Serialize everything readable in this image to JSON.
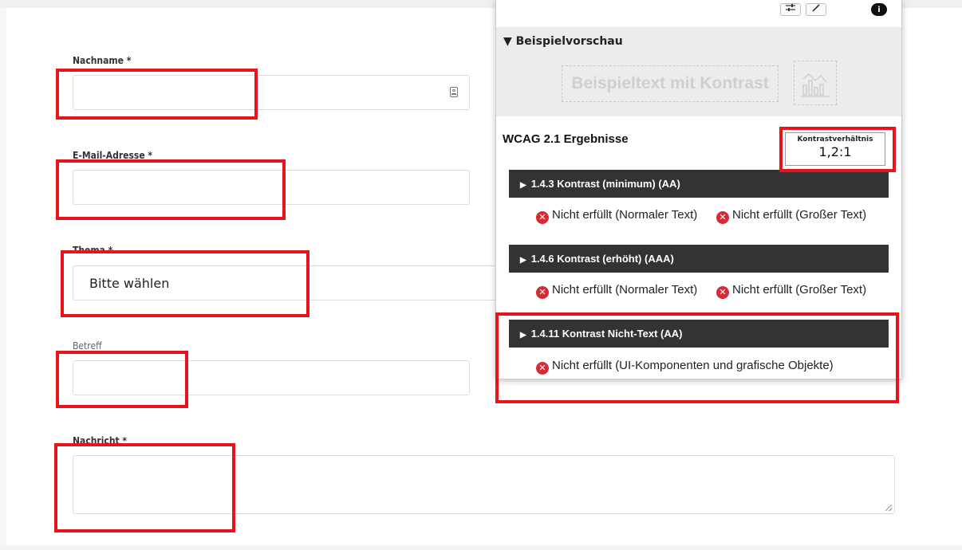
{
  "form": {
    "nachname_label": "Nachname *",
    "email_label": "E-Mail-Adresse *",
    "thema_label": "Thema *",
    "thema_value": "Bitte wählen",
    "betreff_label": "Betreff",
    "nachricht_label": "Nachricht *"
  },
  "panel": {
    "preview_heading": "▼ Beispielvorschau",
    "sample_text": "Beispieltext mit Kontrast",
    "sample_graphic_icon": "chart-icon",
    "results_title": "WCAG 2.1 Ergebnisse",
    "ratio_label": "Kontrastverhältnis",
    "ratio_value": "1,2:1",
    "criteria": [
      {
        "title": "1.4.3 Kontrast (minimum) (AA)",
        "results": [
          "Nicht erfüllt (Normaler Text)",
          "Nicht erfüllt (Großer Text)"
        ]
      },
      {
        "title": "1.4.6 Kontrast (erhöht) (AAA)",
        "results": [
          "Nicht erfüllt (Normaler Text)",
          "Nicht erfüllt (Großer Text)"
        ]
      },
      {
        "title": "1.4.11 Kontrast Nicht-Text (AA)",
        "results": [
          "Nicht erfüllt (UI-Komponenten und grafische Objekte)"
        ]
      }
    ]
  },
  "colors": {
    "highlight": "#e8141a",
    "fail": "#d62b34",
    "criterion_bar": "#333333"
  }
}
